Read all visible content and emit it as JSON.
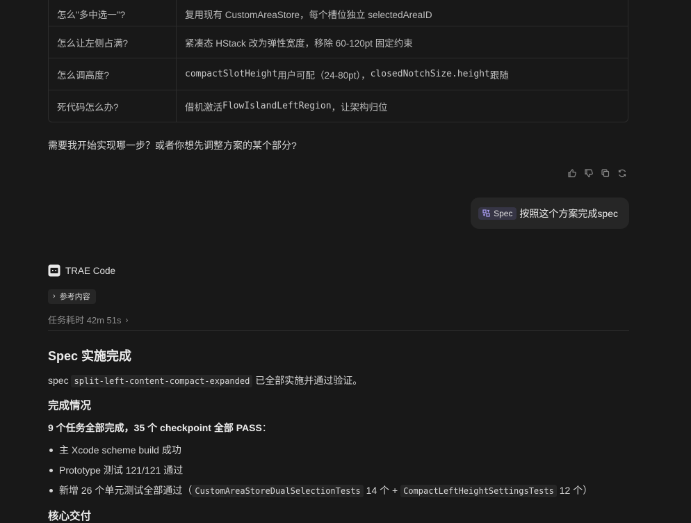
{
  "table": {
    "rows": [
      {
        "q": "怎么\"多中选一\"?",
        "a_parts": [
          {
            "t": "复用现有 CustomAreaStore，每个槽位独立 selectedAreaID",
            "code": false
          }
        ]
      },
      {
        "q": "怎么让左侧占满?",
        "a_parts": [
          {
            "t": "紧凑态 HStack 改为弹性宽度，移除 60-120pt 固定约束",
            "code": false
          }
        ]
      },
      {
        "q": "怎么调高度?",
        "a_parts": [
          {
            "t": "compactSlotHeight",
            "code": true
          },
          {
            "t": " 用户可配（24-80pt），",
            "code": false
          },
          {
            "t": "closedNotchSize.height",
            "code": true
          },
          {
            "t": " 跟随",
            "code": false
          }
        ]
      },
      {
        "q": "死代码怎么办?",
        "a_parts": [
          {
            "t": "借机激活 ",
            "code": false
          },
          {
            "t": "FlowIslandLeftRegion",
            "code": true
          },
          {
            "t": "，让架构归位",
            "code": false
          }
        ]
      }
    ]
  },
  "question": "需要我开始实现哪一步？或者你想先调整方案的某个部分?",
  "user_message": {
    "tag": "Spec",
    "text": "按照这个方案完成spec"
  },
  "agent": {
    "name": "TRAE Code"
  },
  "reference_label": "参考内容",
  "elapsed": "任务耗时 42m 51s",
  "content": {
    "title": "Spec 实施完成",
    "intro_prefix": "spec",
    "intro_code": "split-left-content-compact-expanded",
    "intro_suffix": "已全部实施并通过验证。",
    "section1": "完成情况",
    "summary_bold": "9 个任务全部完成，35 个 checkpoint 全部 PASS",
    "summary_colon": "：",
    "bullet1": "主 Xcode scheme build 成功",
    "bullet2": "Prototype 测试 121/121 通过",
    "bullet3_a": "新增 26 个单元测试全部通过（",
    "bullet3_code1": "CustomAreaStoreDualSelectionTests",
    "bullet3_b": " 14 个 + ",
    "bullet3_code2": "CompactLeftHeightSettingsTests",
    "bullet3_c": " 12 个）",
    "section2": "核心交付"
  }
}
